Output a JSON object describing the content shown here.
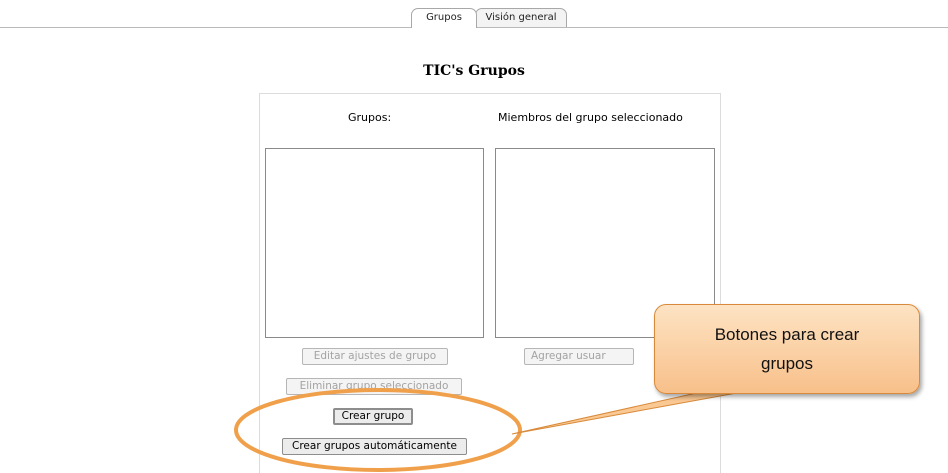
{
  "tabs": [
    {
      "label": "Grupos",
      "active": true
    },
    {
      "label": "Visión general",
      "active": false
    }
  ],
  "page": {
    "title": "TIC's Grupos"
  },
  "groups_panel": {
    "groups_label": "Grupos:",
    "members_label": "Miembros del grupo seleccionado"
  },
  "buttons": {
    "edit_group": "Editar ajustes de grupo",
    "add_users": "Agregar usuar",
    "delete_group": "Eliminar grupo seleccionado",
    "create_group": "Crear grupo",
    "create_groups_auto": "Crear grupos automáticamente"
  },
  "annotation": {
    "line1": "Botones para crear",
    "line2": "grupos",
    "fill_color": "#f8c08a",
    "ellipse_color": "#f0a04b"
  }
}
